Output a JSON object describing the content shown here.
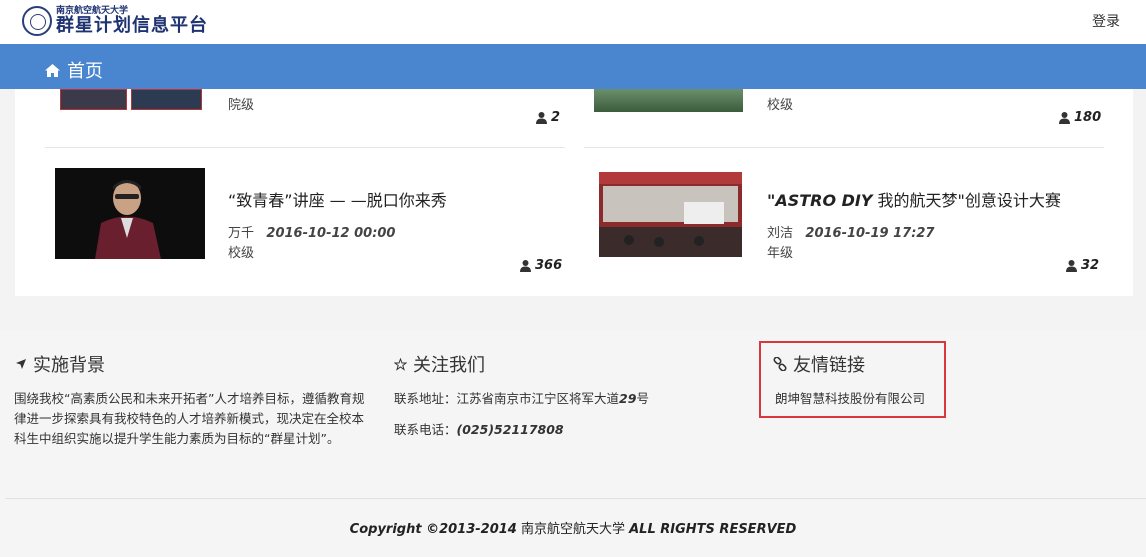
{
  "header": {
    "logo_small": "南京航空航天大学",
    "logo_big": "群星计划信息平台",
    "login_label": "登录"
  },
  "nav": {
    "home_label": "首页"
  },
  "activities_top": [
    {
      "level": "院级",
      "count": "2"
    },
    {
      "level": "校级",
      "count": "180"
    }
  ],
  "activities": [
    {
      "title": "“致青春”讲座 — —脱口你来秀",
      "author": "万千",
      "datetime": "2016-10-12 00:00",
      "level": "校级",
      "count": "366"
    },
    {
      "title_bold": "\"ASTRO DIY",
      "title_rest": " 我的航天梦\"创意设计大赛",
      "author": "刘洁",
      "datetime": "2016-10-19 17:27",
      "level": "年级",
      "count": "32"
    }
  ],
  "footer": {
    "background": {
      "title": "实施背景",
      "text": " 围绕我校“高素质公民和未来开拓者”人才培养目标，遵循教育规律进一步探索具有我校特色的人才培养新模式，现决定在全校本科生中组织实施以提升学生能力素质为目标的“群星计划”。"
    },
    "follow": {
      "title": "关注我们",
      "address_label": "联系地址：",
      "address": "江苏省南京市江宁区将军大道",
      "address_num": "29",
      "address_suffix": "号",
      "phone_label": "联系电话：",
      "phone": "(025)52117808"
    },
    "links": {
      "title": "友情链接",
      "items": [
        "朗坤智慧科技股份有限公司"
      ]
    },
    "copyright_prefix": "Copyright ©2013-2014",
    "copyright_org": " 南京航空航天大学 ",
    "copyright_suffix": "ALL RIGHTS RESERVED"
  },
  "colors": {
    "nav": "#4a86cf",
    "highlight_border": "#d9363e",
    "logo": "#1f3373"
  }
}
